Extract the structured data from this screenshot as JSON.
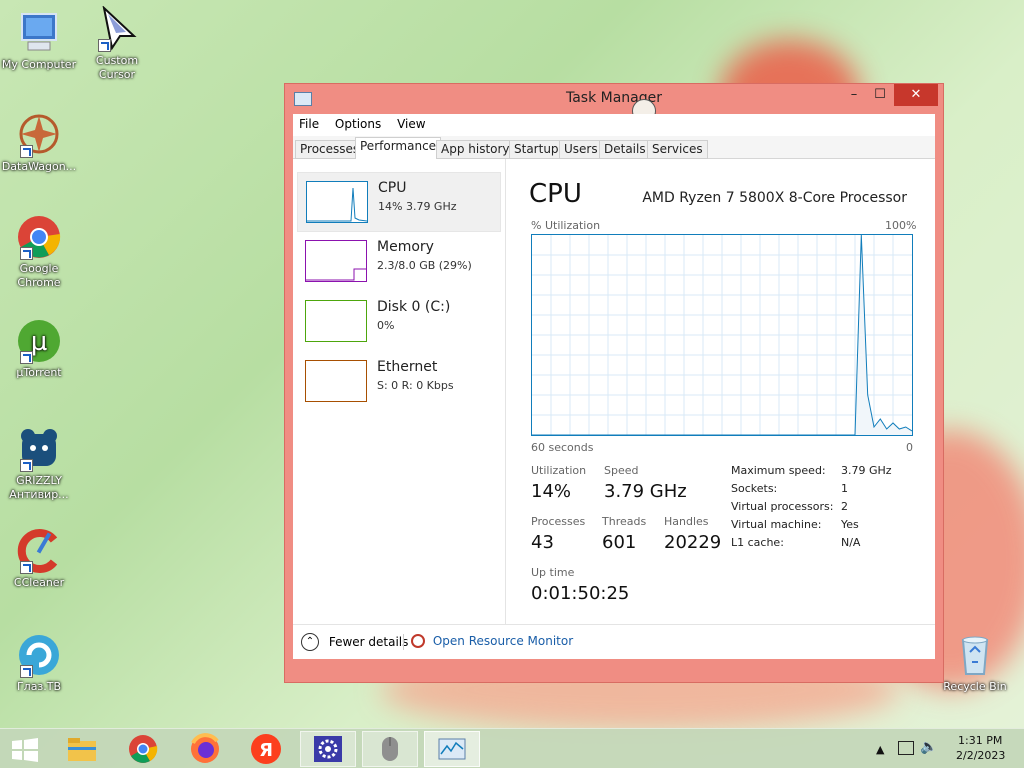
{
  "desktop": {
    "icons": [
      {
        "label": "My Computer"
      },
      {
        "label": "Custom Cursor"
      },
      {
        "label": "DataWagon..."
      },
      {
        "label": "Google Chrome"
      },
      {
        "label": "µTorrent"
      },
      {
        "label": "GRIZZLY Антивир..."
      },
      {
        "label": "CCleaner"
      },
      {
        "label": "Глаз.ТВ"
      },
      {
        "label": "Recycle Bin"
      }
    ]
  },
  "window": {
    "title": "Task Manager",
    "controls": {
      "minimize": "–",
      "maximize": "☐",
      "close": "✕"
    },
    "menu": [
      "File",
      "Options",
      "View"
    ],
    "tabs": [
      "Processes",
      "Performance",
      "App history",
      "Startup",
      "Users",
      "Details",
      "Services"
    ],
    "active_tab": "Performance",
    "resources": [
      {
        "name": "CPU",
        "sub": "14%  3.79 GHz",
        "color": "#117dbb"
      },
      {
        "name": "Memory",
        "sub": "2.3/8.0 GB (29%)",
        "color": "#8b12ae"
      },
      {
        "name": "Disk 0 (C:)",
        "sub": "0%",
        "color": "#4da60c"
      },
      {
        "name": "Ethernet",
        "sub": "S: 0  R: 0 Kbps",
        "color": "#a74f01"
      }
    ],
    "cpu": {
      "heading": "CPU",
      "processor": "AMD Ryzen 7 5800X 8-Core Processor",
      "util_label": "% Utilization",
      "util_max": "100%",
      "time_label": "60 seconds",
      "time_min": "0",
      "utilization_label": "Utilization",
      "utilization": "14%",
      "speed_label": "Speed",
      "speed": "3.79 GHz",
      "processes_label": "Processes",
      "processes": "43",
      "threads_label": "Threads",
      "threads": "601",
      "handles_label": "Handles",
      "handles": "20229",
      "uptime_label": "Up time",
      "uptime": "0:01:50:25",
      "details": [
        {
          "k": "Maximum speed:",
          "v": "3.79 GHz"
        },
        {
          "k": "Sockets:",
          "v": "1"
        },
        {
          "k": "Virtual processors:",
          "v": "2"
        },
        {
          "k": "Virtual machine:",
          "v": "Yes"
        },
        {
          "k": "L1 cache:",
          "v": "N/A"
        }
      ]
    },
    "footer": {
      "fewer": "Fewer details",
      "monitor": "Open Resource Monitor"
    }
  },
  "taskbar": {
    "time": "1:31 PM",
    "date": "2/2/2023",
    "apps": [
      "start-icon",
      "file-explorer-icon",
      "chrome-icon",
      "firefox-icon",
      "yandex-icon",
      "settings-icon",
      "mouse-icon",
      "task-manager-icon"
    ]
  },
  "colors": {
    "window_frame": "#f08d83",
    "cpu_graph": "#117dbb",
    "link": "#1a5ea8"
  },
  "chart_data": {
    "type": "line",
    "title": "",
    "ylabel": "% Utilization",
    "xlabel": "60 seconds",
    "ylim": [
      0,
      100
    ],
    "xlim": [
      60,
      0
    ],
    "series": [
      {
        "x": [
          60,
          58,
          56,
          54,
          52,
          50,
          48,
          46,
          44,
          42,
          40,
          38,
          36,
          34,
          32,
          30,
          28,
          26,
          24,
          22,
          20,
          18,
          16,
          14,
          12,
          10,
          9,
          8,
          7,
          6,
          5,
          4,
          3,
          2,
          1,
          0
        ],
        "values": [
          0,
          0,
          0,
          0,
          0,
          0,
          0,
          0,
          0,
          0,
          0,
          0,
          0,
          0,
          0,
          0,
          0,
          0,
          0,
          0,
          0,
          0,
          0,
          0,
          0,
          0,
          0,
          100,
          20,
          4,
          8,
          3,
          6,
          3,
          4,
          2
        ]
      }
    ]
  }
}
